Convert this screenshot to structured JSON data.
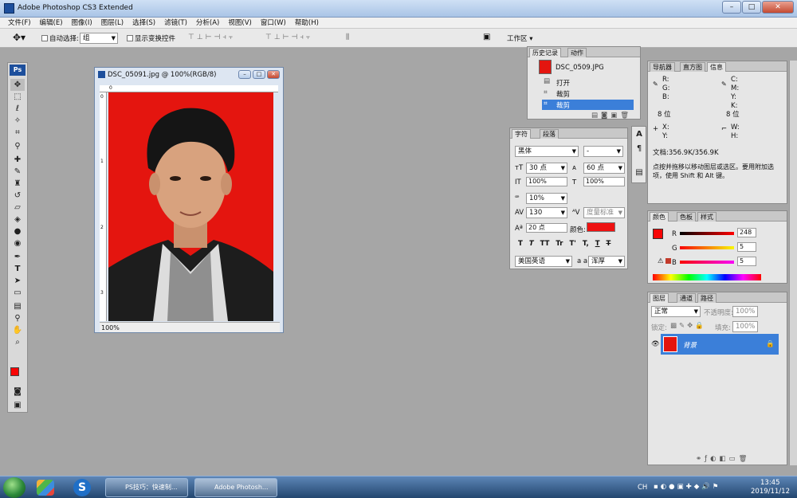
{
  "window": {
    "title": "Adobe Photoshop CS3 Extended"
  },
  "menu": [
    "文件(F)",
    "编辑(E)",
    "图像(I)",
    "图层(L)",
    "选择(S)",
    "滤镜(T)",
    "分析(A)",
    "视图(V)",
    "窗口(W)",
    "帮助(H)"
  ],
  "options": {
    "auto_select_label": "自动选择:",
    "auto_select_value": "组",
    "show_transform_label": "显示变换控件",
    "workspace_label": "工作区 ▾"
  },
  "toolbox": {
    "logo": "Ps"
  },
  "document": {
    "title": "DSC_05091.jpg @ 100%(RGB/8)",
    "zoom": "100%",
    "ruler_marks": [
      "0",
      "1",
      "2",
      "3"
    ],
    "ruler_top_mark": "0"
  },
  "history": {
    "tabs": [
      "历史记录",
      "动作"
    ],
    "snapshot": "DSC_0509.JPG",
    "items": [
      "打开",
      "裁剪",
      "裁剪"
    ],
    "selected_index": 2
  },
  "character": {
    "tabs": [
      "字符",
      "段落"
    ],
    "font_family": "黑体",
    "font_style": "-",
    "font_size": "30 点",
    "leading": "60 点",
    "vertical_scale": "100%",
    "horizontal_scale": "100%",
    "baseline_scale": "10%",
    "tracking": "130",
    "kerning": "度量标准",
    "baseline_shift": "20 点",
    "color_label": "颜色:",
    "color": "#ee1111",
    "language": "美国英语",
    "antialias_label": "a a",
    "antialias": "浑厚",
    "style_buttons": [
      "T",
      "T",
      "TT",
      "Tr",
      "T'",
      "T,",
      "T",
      "T"
    ]
  },
  "info": {
    "tabs": [
      "导航器",
      "直方图",
      "信息"
    ],
    "r": "R:",
    "g": "G:",
    "b": "B:",
    "bits_left": "8 位",
    "c": "C:",
    "m": "M:",
    "y": "Y:",
    "k": "K:",
    "bits_right": "8 位",
    "x": "X:",
    "yy": "Y:",
    "w": "W:",
    "h": "H:",
    "doc": "文档:356.9K/356.9K",
    "hint": "点按并拖移以移动图层或选区。要用附加选项，使用 Shift 和 Alt 键。"
  },
  "color": {
    "tabs": [
      "颜色",
      "色板",
      "样式"
    ],
    "r_label": "R",
    "r_value": "248",
    "g_label": "G",
    "g_value": "5",
    "b_label": "B",
    "b_value": "5",
    "swatch": "#f80505"
  },
  "layers": {
    "tabs": [
      "图层",
      "通道",
      "路径"
    ],
    "blend": "正常",
    "opacity_label": "不透明度:",
    "opacity": "100%",
    "lock_label": "锁定:",
    "fill_label": "填充:",
    "fill": "100%",
    "layer_name": "背景"
  },
  "taskbar": {
    "item1": "PS技巧：快速制...",
    "item2": "Adobe Photosh...",
    "lang": "CH",
    "time": "13:45",
    "date": "2019/11/12"
  }
}
